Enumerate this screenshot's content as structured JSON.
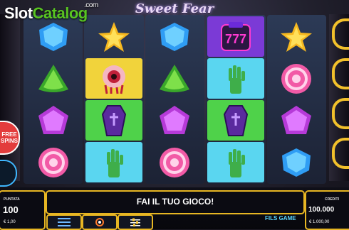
{
  "watermark": {
    "part_a": "Slot",
    "part_b": "Catalog",
    "com": ".com"
  },
  "game": {
    "title": "Sweet Fear"
  },
  "side": {
    "badge_text": "FREE SPINS"
  },
  "reels": [
    [
      {
        "symbol": "candy-blue"
      },
      {
        "symbol": "candy-green"
      },
      {
        "symbol": "candy-purple"
      },
      {
        "symbol": "candy-pink"
      }
    ],
    [
      {
        "symbol": "candy-yellow-star"
      },
      {
        "symbol": "eyeball",
        "highlight": "yellow"
      },
      {
        "symbol": "coffin",
        "highlight": "green"
      },
      {
        "symbol": "zombie-hand",
        "highlight": "cyan"
      }
    ],
    [
      {
        "symbol": "candy-blue"
      },
      {
        "symbol": "candy-green"
      },
      {
        "symbol": "candy-purple"
      },
      {
        "symbol": "candy-pink"
      }
    ],
    [
      {
        "symbol": "777-bag",
        "highlight": "purple",
        "text": "777"
      },
      {
        "symbol": "zombie-hand",
        "highlight": "cyan"
      },
      {
        "symbol": "coffin",
        "highlight": "green"
      },
      {
        "symbol": "zombie-hand",
        "highlight": "cyan"
      }
    ],
    [
      {
        "symbol": "candy-yellow-star"
      },
      {
        "symbol": "candy-pink"
      },
      {
        "symbol": "candy-purple"
      },
      {
        "symbol": "candy-blue"
      }
    ]
  ],
  "bottom": {
    "message": "FAI IL TUO GIOCO!",
    "bet_label": "PUNTATA",
    "bet_value": "100",
    "bet_sub": "€ 1,00",
    "credit_label": "CREDITI",
    "credit_value": "100.000",
    "credit_sub": "€ 1.000,00",
    "logo_line1": "FILS",
    "logo_line2": "GAME"
  },
  "colors": {
    "frame": "#e7b623",
    "accent_green": "#58c322"
  },
  "icons": {
    "menu": "hamburger-menu-icon",
    "autoplay": "autoplay-icon",
    "settings": "sliders-icon"
  }
}
